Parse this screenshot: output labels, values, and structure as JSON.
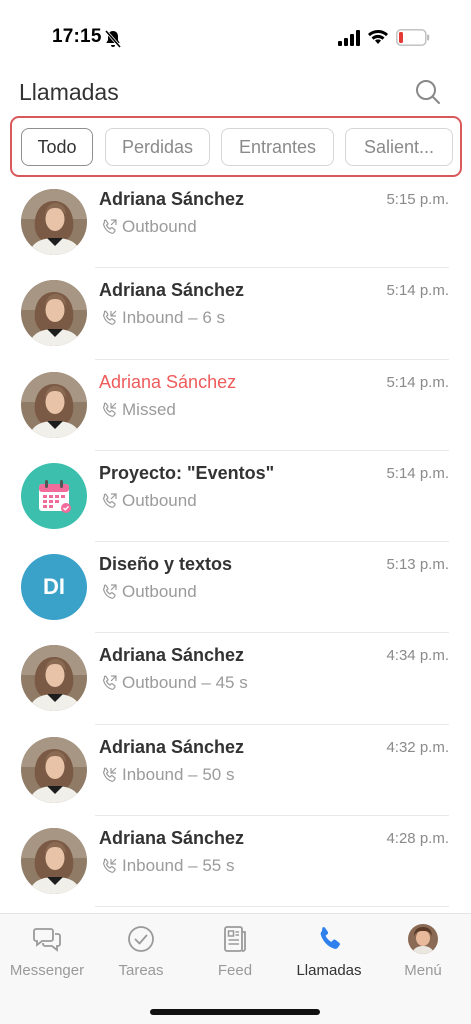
{
  "status_bar": {
    "time": "17:15"
  },
  "header": {
    "title": "Llamadas"
  },
  "filters": [
    {
      "label": "Todo",
      "active": true
    },
    {
      "label": "Perdidas",
      "active": false
    },
    {
      "label": "Entrantes",
      "active": false
    },
    {
      "label": "Salient...",
      "active": false
    }
  ],
  "calls": [
    {
      "name": "Adriana Sánchez",
      "time": "5:15 p.m.",
      "detail": "Outbound",
      "avatar": "photo",
      "missed": false
    },
    {
      "name": "Adriana Sánchez",
      "time": "5:14 p.m.",
      "detail": "Inbound – 6 s",
      "avatar": "photo",
      "missed": false
    },
    {
      "name": "Adriana Sánchez",
      "time": "5:14 p.m.",
      "detail": "Missed",
      "avatar": "photo",
      "missed": true
    },
    {
      "name": "Proyecto: \"Eventos\"",
      "time": "5:14 p.m.",
      "detail": "Outbound",
      "avatar": "calendar",
      "missed": false
    },
    {
      "name": "Diseño y textos",
      "time": "5:13 p.m.",
      "detail": "Outbound",
      "avatar": "initials",
      "initials": "DI",
      "missed": false
    },
    {
      "name": "Adriana Sánchez",
      "time": "4:34 p.m.",
      "detail": "Outbound – 45 s",
      "avatar": "photo",
      "missed": false
    },
    {
      "name": "Adriana Sánchez",
      "time": "4:32 p.m.",
      "detail": "Inbound – 50 s",
      "avatar": "photo",
      "missed": false
    },
    {
      "name": "Adriana Sánchez",
      "time": "4:28 p.m.",
      "detail": "Inbound – 55 s",
      "avatar": "photo",
      "missed": false
    }
  ],
  "tabbar": {
    "messenger": "Messenger",
    "tareas": "Tareas",
    "feed": "Feed",
    "llamadas": "Llamadas",
    "menu": "Menú",
    "active": "llamadas"
  },
  "colors": {
    "accent": "#2f80ed",
    "missed": "#ef5b5b",
    "highlight_border": "#d9585c",
    "initials_bg": "#3aa1c9",
    "calendar_bg": "#3dbfad"
  }
}
